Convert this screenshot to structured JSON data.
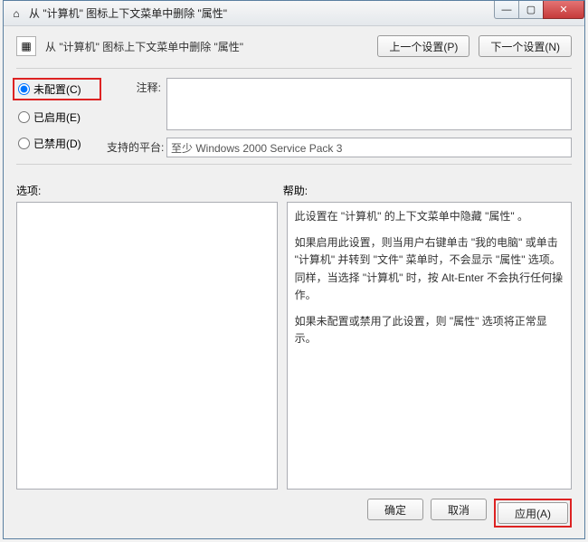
{
  "window": {
    "title": "从 \"计算机\" 图标上下文菜单中删除 \"属性\""
  },
  "header": {
    "label": "从 \"计算机\" 图标上下文菜单中删除 \"属性\"",
    "prev_btn": "上一个设置(P)",
    "next_btn": "下一个设置(N)"
  },
  "radios": {
    "not_configured": "未配置(C)",
    "enabled": "已启用(E)",
    "disabled": "已禁用(D)",
    "selected": "not_configured"
  },
  "fields": {
    "comment_label": "注释:",
    "comment_value": "",
    "platform_label": "支持的平台:",
    "platform_value": "至少 Windows 2000 Service Pack 3"
  },
  "sections": {
    "options_label": "选项:",
    "help_label": "帮助:"
  },
  "help_text": {
    "p1": "此设置在 \"计算机\" 的上下文菜单中隐藏 \"属性\" 。",
    "p2": "如果启用此设置，则当用户右键单击 \"我的电脑\" 或单击 \"计算机\" 并转到 \"文件\" 菜单时，不会显示 \"属性\" 选项。同样，当选择 \"计算机\" 时，按 Alt-Enter 不会执行任何操作。",
    "p3": "如果未配置或禁用了此设置，则 \"属性\" 选项将正常显示。"
  },
  "buttons": {
    "ok": "确定",
    "cancel": "取消",
    "apply": "应用(A)"
  },
  "icons": {
    "app": "⌂",
    "policy": "▦"
  }
}
